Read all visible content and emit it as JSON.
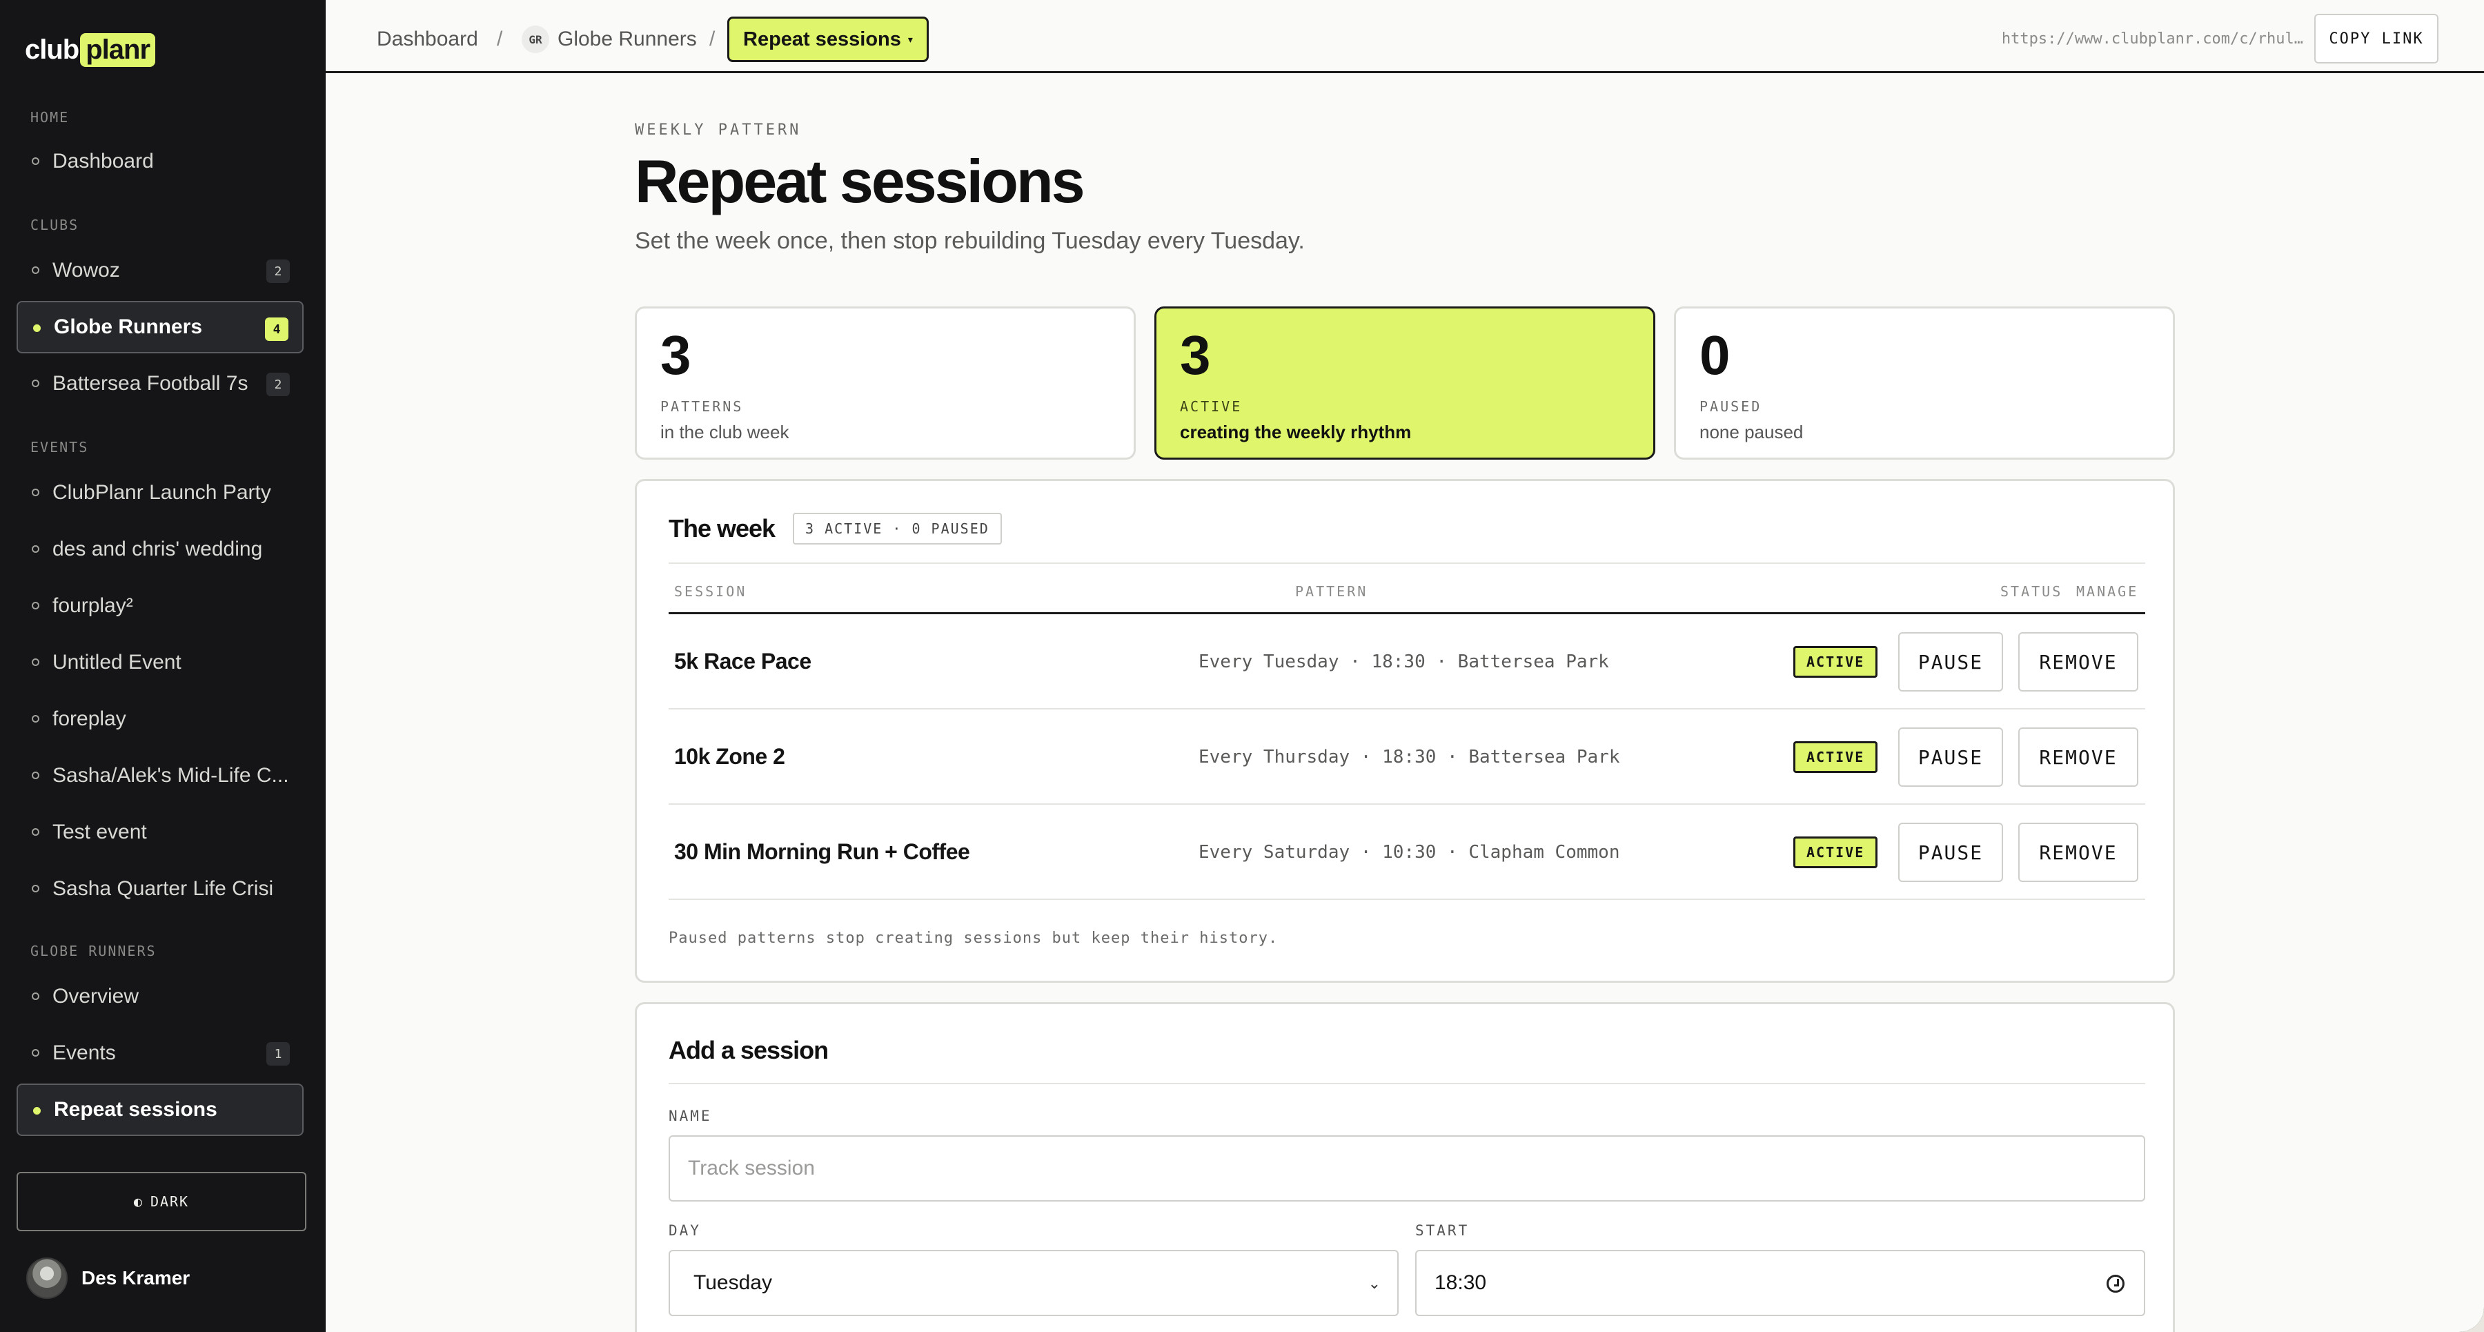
{
  "brand": {
    "part1": "club",
    "part2": "planr"
  },
  "sidebar": {
    "sections": {
      "home": "HOME",
      "clubs": "CLUBS",
      "events": "EVENTS",
      "globe_runners": "GLOBE RUNNERS"
    },
    "home_items": [
      {
        "label": "Dashboard"
      }
    ],
    "club_items": [
      {
        "label": "Wowoz",
        "badge": "2"
      },
      {
        "label": "Globe Runners",
        "badge": "4",
        "active": true
      },
      {
        "label": "Battersea Football 7s",
        "badge": "2"
      }
    ],
    "event_items": [
      {
        "label": "ClubPlanr Launch Party"
      },
      {
        "label": "des and chris' wedding"
      },
      {
        "label": "fourplay²"
      },
      {
        "label": "Untitled Event"
      },
      {
        "label": "foreplay"
      },
      {
        "label": "Sasha/Alek's Mid-Life C..."
      },
      {
        "label": "Test event"
      },
      {
        "label": "Sasha Quarter Life Crisi"
      }
    ],
    "club_nav_items": [
      {
        "label": "Overview"
      },
      {
        "label": "Events",
        "badge": "1"
      },
      {
        "label": "Repeat sessions",
        "active": true
      }
    ],
    "dark_toggle": {
      "icon": "◐",
      "label": "DARK"
    },
    "user": {
      "name": "Des Kramer"
    }
  },
  "topbar": {
    "breadcrumb": {
      "root": "Dashboard",
      "club_initials": "GR",
      "club": "Globe Runners",
      "current": "Repeat sessions",
      "caret": "▾",
      "separator": "/"
    },
    "url": "https://www.clubplanr.com/c/rhul…",
    "copy_label": "COPY LINK"
  },
  "page": {
    "eyebrow": "WEEKLY PATTERN",
    "title": "Repeat sessions",
    "subtitle": "Set the week once, then stop rebuilding Tuesday every Tuesday."
  },
  "stats": [
    {
      "value": "3",
      "label": "PATTERNS",
      "desc": "in the club week"
    },
    {
      "value": "3",
      "label": "ACTIVE",
      "desc": "creating the weekly rhythm",
      "highlight": true
    },
    {
      "value": "0",
      "label": "PAUSED",
      "desc": "none paused"
    }
  ],
  "week": {
    "title": "The week",
    "summary_chip": "3 ACTIVE · 0 PAUSED",
    "columns": {
      "session": "SESSION",
      "pattern": "PATTERN",
      "status": "STATUS",
      "manage": "MANAGE"
    },
    "rows": [
      {
        "name": "5k Race Pace",
        "pattern": "Every Tuesday · 18:30 · Battersea Park",
        "status": "ACTIVE",
        "pause": "PAUSE",
        "remove": "REMOVE"
      },
      {
        "name": "10k Zone 2",
        "pattern": "Every Thursday · 18:30 · Battersea Park",
        "status": "ACTIVE",
        "pause": "PAUSE",
        "remove": "REMOVE"
      },
      {
        "name": "30 Min Morning Run + Coffee",
        "pattern": "Every Saturday · 10:30 · Clapham Common",
        "status": "ACTIVE",
        "pause": "PAUSE",
        "remove": "REMOVE"
      }
    ],
    "footnote": "Paused patterns stop creating sessions but keep their history."
  },
  "add_session": {
    "title": "Add a session",
    "name_label": "NAME",
    "name_placeholder": "Track session",
    "day_label": "DAY",
    "day_value": "Tuesday",
    "start_label": "START",
    "start_value": "18:30"
  },
  "colors": {
    "accent": "#dff56b",
    "sidebar_bg": "#151517",
    "page_bg": "#fafaf8"
  }
}
